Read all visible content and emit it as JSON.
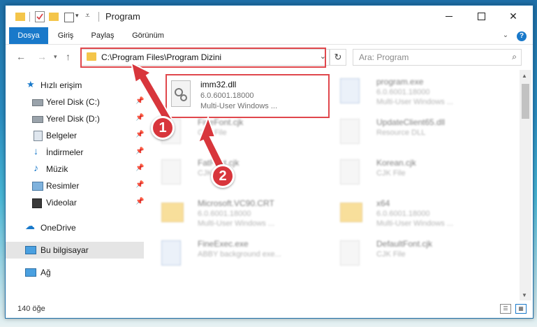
{
  "window": {
    "title": "Program"
  },
  "ribbon": {
    "tabs": [
      "Dosya",
      "Giriş",
      "Paylaş",
      "Görünüm"
    ]
  },
  "address": {
    "path": "C:\\Program Files\\Program Dizini"
  },
  "search": {
    "placeholder": "Ara: Program"
  },
  "sidebar": {
    "quick_access": "Hızlı erişim",
    "items": [
      {
        "label": "Yerel Disk (C:)",
        "icon": "drive-icon"
      },
      {
        "label": "Yerel Disk (D:)",
        "icon": "drive-icon"
      },
      {
        "label": "Belgeler",
        "icon": "documents-icon"
      },
      {
        "label": "İndirmeler",
        "icon": "downloads-icon"
      },
      {
        "label": "Müzik",
        "icon": "music-icon"
      },
      {
        "label": "Resimler",
        "icon": "pictures-icon"
      },
      {
        "label": "Videolar",
        "icon": "videos-icon"
      }
    ],
    "onedrive": "OneDrive",
    "this_pc": "Bu bilgisayar",
    "network": "Ağ"
  },
  "files": {
    "highlighted": {
      "name": "imm32.dll",
      "version": "6.0.6001.18000",
      "description": "Multi-User Windows ..."
    },
    "left": [
      {
        "name": "FineFont.cjk",
        "line1": "CJK File",
        "line2": ""
      },
      {
        "name": "FatFont.cjk",
        "line1": "CJK File",
        "line2": ""
      },
      {
        "name": "Microsoft.VC90.CRT",
        "line1": "6.0.6001.18000",
        "line2": "Multi-User Windows ..."
      },
      {
        "name": "FineExec.exe",
        "line1": "ABBY background exe...",
        "line2": ""
      }
    ],
    "right": [
      {
        "name": "program.exe",
        "line1": "6.0.6001.18000",
        "line2": "Multi-User Windows ..."
      },
      {
        "name": "UpdateClient65.dll",
        "line1": "Resource DLL",
        "line2": ""
      },
      {
        "name": "Korean.cjk",
        "line1": "CJK File",
        "line2": ""
      },
      {
        "name": "x64",
        "line1": "6.0.6001.18000",
        "line2": "Multi-User Windows ..."
      },
      {
        "name": "DefaultFont.cjk",
        "line1": "CJK File",
        "line2": ""
      }
    ]
  },
  "status": {
    "count": "140 öğe"
  },
  "annotations": {
    "step1": "1",
    "step2": "2"
  },
  "colors": {
    "accent": "#1979ca",
    "highlight": "#e0474c",
    "badge": "#d8363c"
  }
}
